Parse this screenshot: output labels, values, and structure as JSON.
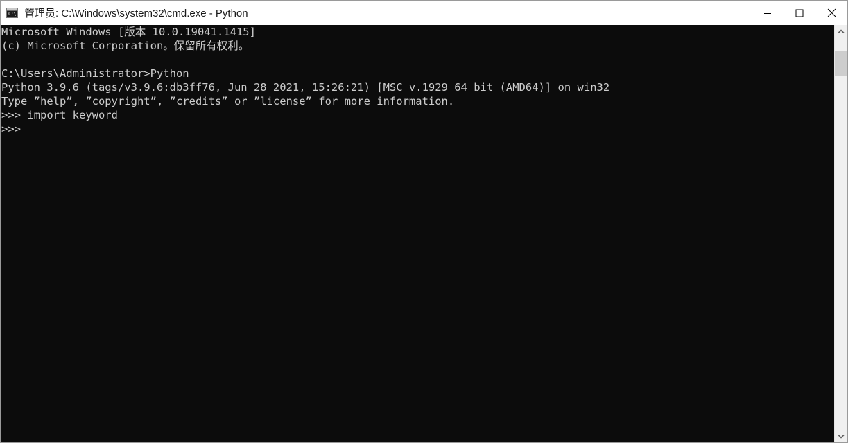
{
  "window": {
    "title": "管理员: C:\\Windows\\system32\\cmd.exe - Python",
    "icon_name": "cmd-console-icon",
    "icon_glyph": "C:\\.",
    "background_color": "#0c0c0c",
    "titlebar_color": "#ffffff",
    "text_color": "#cccccc"
  },
  "controls": {
    "minimize_label": "最小化",
    "maximize_label": "最大化",
    "close_label": "关闭"
  },
  "scrollbar": {
    "up_arrow_label": "向上滚动",
    "down_arrow_label": "向下滚动",
    "thumb_label": "滚动条滑块"
  },
  "console": {
    "lines": [
      "Microsoft Windows [版本 10.0.19041.1415]",
      "(c) Microsoft Corporation。保留所有权利。",
      "",
      "C:\\Users\\Administrator>Python",
      "Python 3.9.6 (tags/v3.9.6:db3ff76, Jun 28 2021, 15:26:21) [MSC v.1929 64 bit (AMD64)] on win32",
      "Type ”help”, ”copyright”, ”credits” or ”license” for more information.",
      ">>> import keyword",
      ">>>"
    ]
  }
}
